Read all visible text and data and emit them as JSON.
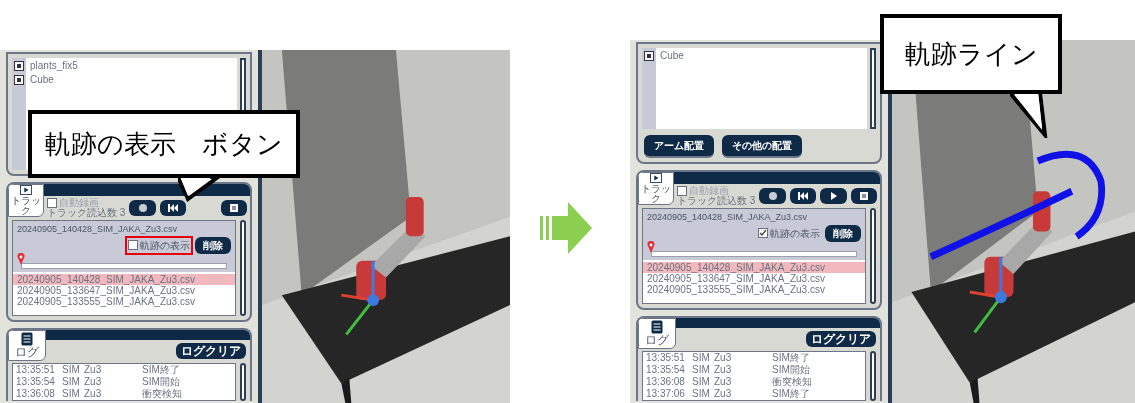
{
  "screens": [
    {
      "objects": [
        {
          "name": "plants_fix5"
        },
        {
          "name": "Cube"
        }
      ],
      "track": {
        "tab_label": "トラック",
        "auto_record": {
          "label": "自動録画",
          "checked": false
        },
        "load_count": "トラック読込数 3",
        "controls": [
          {
            "kind": "record"
          },
          {
            "kind": "rewind"
          },
          {
            "kind": "stop"
          }
        ],
        "current_file": {
          "name": "20240905_140428_SIM_JAKA_Zu3.csv",
          "show_trajectory": {
            "label": "軌跡の表示",
            "checked": false,
            "highlight": true
          },
          "delete_label": "削除",
          "level": 0
        },
        "files": [
          {
            "name": "20240905_140428_SIM_JAKA_Zu3.csv",
            "selected": true
          },
          {
            "name": "20240905_133647_SIM_JAKA_Zu3.csv",
            "selected": false
          },
          {
            "name": "20240905_133555_SIM_JAKA_Zu3.csv",
            "selected": false
          }
        ]
      },
      "log": {
        "tab_label": "ログ",
        "clear_label": "ログクリア",
        "rows": [
          {
            "time": "13:35:51",
            "source": "SIM",
            "device": "Zu3",
            "message": "SIM終了"
          },
          {
            "time": "13:35:54",
            "source": "SIM",
            "device": "Zu3",
            "message": "SIM開始"
          },
          {
            "time": "13:36:08",
            "source": "SIM",
            "device": "Zu3",
            "message": "衝突検知"
          }
        ]
      }
    },
    {
      "objects": [
        {
          "name": "Cube"
        }
      ],
      "place_buttons": [
        "アーム配置",
        "その他の配置"
      ],
      "track": {
        "tab_label": "トラック",
        "auto_record": {
          "label": "自動録画",
          "checked": false
        },
        "load_count": "トラック読込数 3",
        "controls": [
          {
            "kind": "record"
          },
          {
            "kind": "rewind"
          },
          {
            "kind": "play"
          },
          {
            "kind": "stop"
          }
        ],
        "current_file": {
          "name": "20240905_140428_SIM_JAKA_Zu3.csv",
          "show_trajectory": {
            "label": "軌跡の表示",
            "checked": true,
            "highlight": false
          },
          "delete_label": "削除",
          "level": 0
        },
        "files": [
          {
            "name": "20240905_140428_SIM_JAKA_Zu3.csv",
            "selected": true
          },
          {
            "name": "20240905_133647_SIM_JAKA_Zu3.csv",
            "selected": false
          },
          {
            "name": "20240905_133555_SIM_JAKA_Zu3.csv",
            "selected": false
          }
        ]
      },
      "log": {
        "tab_label": "ログ",
        "clear_label": "ログクリア",
        "rows": [
          {
            "time": "13:35:51",
            "source": "SIM",
            "device": "Zu3",
            "message": "SIM終了"
          },
          {
            "time": "13:35:54",
            "source": "SIM",
            "device": "Zu3",
            "message": "SIM開始"
          },
          {
            "time": "13:36:08",
            "source": "SIM",
            "device": "Zu3",
            "message": "衝突検知"
          },
          {
            "time": "13:37:06",
            "source": "SIM",
            "device": "Zu3",
            "message": "SIM終了"
          }
        ]
      }
    }
  ],
  "callouts": [
    {
      "text": "軌跡の表示　ボタン"
    },
    {
      "text": "軌跡ライン"
    }
  ]
}
